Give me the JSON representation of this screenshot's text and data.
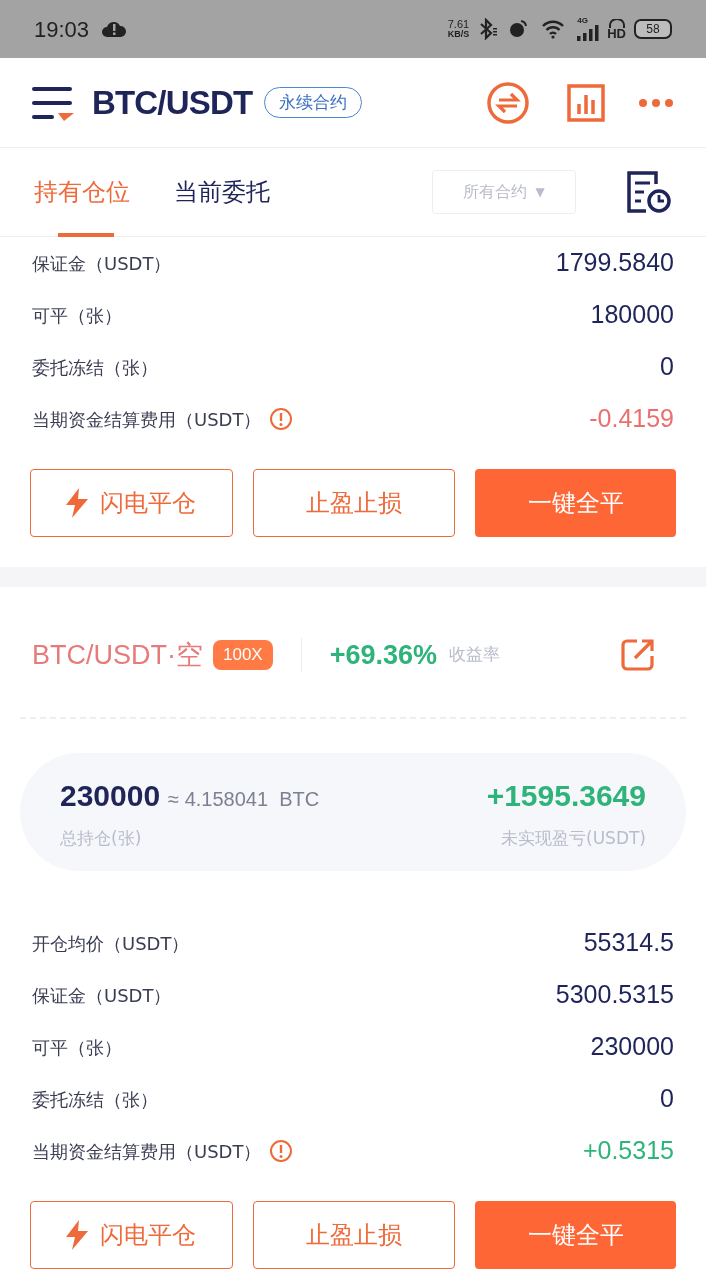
{
  "status_bar": {
    "time": "19:03",
    "net_speed": [
      "7.61",
      "KB/S"
    ],
    "network": "4G",
    "hd": "HD",
    "battery": "58"
  },
  "header": {
    "title": "BTC/USDT",
    "badge": "永续合约"
  },
  "tabs": [
    {
      "label": "持有仓位",
      "selected": true
    },
    {
      "label": "当前委托",
      "selected": false
    }
  ],
  "filter": {
    "label": "所有合约",
    "caret": "▼"
  },
  "positions": [
    {
      "rows": [
        {
          "label": "保证金（USDT）",
          "value": "1799.5840",
          "color": "#1f2459",
          "info": false
        },
        {
          "label": "可平（张）",
          "value": "180000",
          "color": "#1f2459",
          "info": false
        },
        {
          "label": "委托冻结（张）",
          "value": "0",
          "color": "#1f2459",
          "info": false
        },
        {
          "label": "当期资金结算费用（USDT）",
          "value": "-0.4159",
          "color": "#ec6f6f",
          "info": true
        }
      ],
      "buttons": [
        {
          "label": "闪电平仓",
          "kind": "flash"
        },
        {
          "label": "止盈止损",
          "kind": "outline"
        },
        {
          "label": "一键全平",
          "kind": "primary"
        }
      ]
    },
    {
      "title": {
        "pair": "BTC/USDT·空",
        "leverage": "100X",
        "yield": "+69.36%",
        "yield_label": "收益率"
      },
      "summary": {
        "size": "230000",
        "approx": "≈ 4.158041  BTC",
        "size_label": "总持仓(张)",
        "pnl": "+1595.3649",
        "pnl_label": "未实现盈亏(USDT)"
      },
      "rows": [
        {
          "label": "开仓均价（USDT）",
          "value": "55314.5",
          "color": "#1f2459",
          "info": false
        },
        {
          "label": "保证金（USDT）",
          "value": "5300.5315",
          "color": "#1f2459",
          "info": false
        },
        {
          "label": "可平（张）",
          "value": "230000",
          "color": "#1f2459",
          "info": false
        },
        {
          "label": "委托冻结（张）",
          "value": "0",
          "color": "#1f2459",
          "info": false
        },
        {
          "label": "当期资金结算费用（USDT）",
          "value": "+0.5315",
          "color": "#2eb37a",
          "info": true
        }
      ],
      "buttons": [
        {
          "label": "闪电平仓",
          "kind": "flash"
        },
        {
          "label": "止盈止损",
          "kind": "outline"
        },
        {
          "label": "一键全平",
          "kind": "primary"
        }
      ]
    }
  ]
}
